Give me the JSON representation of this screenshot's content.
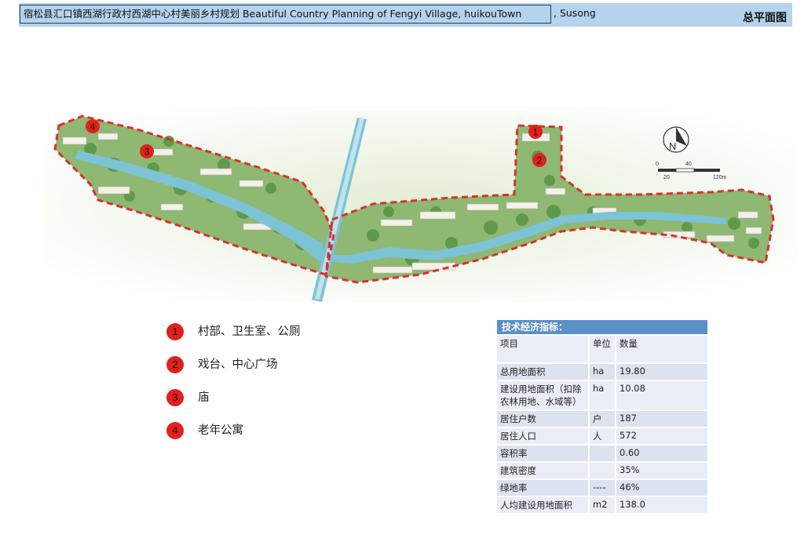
{
  "header": {
    "title": "宿松县汇口镇西湖行政村西湖中心村美丽乡村规划  Beautiful  Country  Planning  of  Fengyi  Village,  huikouTown",
    "title_tail": ",  Susong",
    "sheet_title": "总平面图"
  },
  "map": {
    "markers": [
      {
        "num": "1"
      },
      {
        "num": "2"
      },
      {
        "num": "3"
      },
      {
        "num": "4"
      }
    ],
    "compass_label": "N",
    "scale_labels": [
      "0",
      "40",
      "20",
      "120m"
    ],
    "colors": {
      "boundary": "#d9302c",
      "river": "#7cc3d6",
      "green": "#5e9a4a",
      "background": "#e6efd9"
    }
  },
  "legend": [
    {
      "num": "1",
      "label": "村部、卫生室、公厕"
    },
    {
      "num": "2",
      "label": "戏台、中心广场"
    },
    {
      "num": "3",
      "label": "庙"
    },
    {
      "num": "4",
      "label": "老年公寓"
    }
  ],
  "tech_table": {
    "title": "技术经济指标：",
    "header": {
      "item": "项目",
      "unit": "单位",
      "value": "数量"
    },
    "rows": [
      {
        "item": "总用地面积",
        "unit": "ha",
        "value": "19.80"
      },
      {
        "item": "建设用地面积（扣除农林用地、水域等）",
        "unit": "ha",
        "value": "10.08"
      },
      {
        "item": "居住户数",
        "unit": "户",
        "value": "187"
      },
      {
        "item": "居住人口",
        "unit": "人",
        "value": "572"
      },
      {
        "item": "容积率",
        "unit": "",
        "value": "0.60"
      },
      {
        "item": "建筑密度",
        "unit": "",
        "value": "35%"
      },
      {
        "item": "绿地率",
        "unit": "----",
        "value": "46%"
      },
      {
        "item": "人均建设用地面积",
        "unit": "m2",
        "value": "138.0"
      }
    ]
  }
}
